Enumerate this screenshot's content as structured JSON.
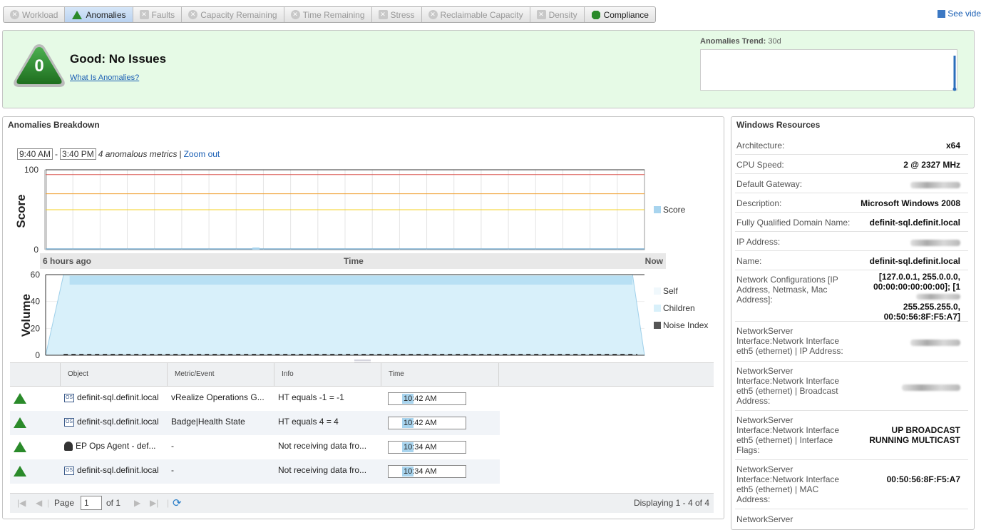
{
  "tabs": [
    {
      "label": "Workload",
      "icon": "workload-icon"
    },
    {
      "label": "Anomalies",
      "icon": "anomalies-icon"
    },
    {
      "label": "Faults",
      "icon": "faults-icon"
    },
    {
      "label": "Capacity Remaining",
      "icon": "capacity-icon"
    },
    {
      "label": "Time Remaining",
      "icon": "time-icon"
    },
    {
      "label": "Stress",
      "icon": "stress-icon"
    },
    {
      "label": "Reclaimable Capacity",
      "icon": "reclaimable-icon"
    },
    {
      "label": "Density",
      "icon": "density-icon"
    },
    {
      "label": "Compliance",
      "icon": "compliance-icon"
    }
  ],
  "see_video": "See vide",
  "status": {
    "score": "0",
    "title": "Good: No Issues",
    "link": "What Is Anomalies?",
    "trend_label": "Anomalies Trend:",
    "trend_period": "30d"
  },
  "breakdown": {
    "title": "Anomalies Breakdown",
    "range_start": "9:40 AM",
    "range_sep": "-",
    "range_end": "3:40 PM",
    "range_note": "4 anomalous metrics",
    "range_pipe": "|",
    "zoom_out": "Zoom out",
    "time_axis": {
      "left": "6 hours ago",
      "center": "Time",
      "right": "Now"
    }
  },
  "chart_data": [
    {
      "type": "line",
      "ylabel": "Score",
      "ylim": [
        0,
        100
      ],
      "yticks": [
        "100",
        "0"
      ],
      "thresholds": [
        {
          "value": 94,
          "color": "#d9534f"
        },
        {
          "value": 70,
          "color": "#f0a030"
        },
        {
          "value": 50,
          "color": "#f5d020"
        }
      ],
      "series": [
        {
          "name": "Score",
          "values": [
            0,
            0,
            0,
            0,
            0,
            0,
            0,
            0,
            0,
            0,
            0,
            0,
            0,
            0,
            0,
            0,
            0,
            0,
            0,
            0,
            0,
            0
          ],
          "color": "#a8d4ee"
        }
      ],
      "legend": "right"
    },
    {
      "type": "area",
      "ylabel": "Volume",
      "ylim": [
        0,
        60
      ],
      "yticks": [
        "60",
        "40",
        "20",
        "0"
      ],
      "x": [
        0,
        0.03,
        0.98,
        1
      ],
      "series": [
        {
          "name": "Self",
          "values": [
            0,
            0,
            0,
            0
          ],
          "color": "#f0f8fc"
        },
        {
          "name": "Children",
          "values": [
            0,
            60,
            60,
            0
          ],
          "color": "#d8f0fa"
        },
        {
          "name": "Noise Index",
          "values": [
            0,
            0,
            0,
            0
          ],
          "color": "#555555"
        }
      ],
      "legend": "right"
    }
  ],
  "grid": {
    "headers": [
      "Object",
      "Metric/Event",
      "Info",
      "Time"
    ],
    "rows": [
      {
        "object": "definit-sql.definit.local",
        "type": "os",
        "metric": "vRealize Operations G...",
        "info": "HT equals -1 = -1",
        "time": "10:42 AM"
      },
      {
        "object": "definit-sql.definit.local",
        "type": "os",
        "metric": "Badge|Health State",
        "info": "HT equals 4 = 4",
        "time": "10:42 AM"
      },
      {
        "object": "EP Ops Agent - def...",
        "type": "agent",
        "metric": "-",
        "info": "Not receiving data fro...",
        "time": "10:34 AM"
      },
      {
        "object": "definit-sql.definit.local",
        "type": "os",
        "metric": "-",
        "info": "Not receiving data fro...",
        "time": "10:34 AM"
      }
    ],
    "pager": {
      "page_label": "Page",
      "page": "1",
      "of": "of 1",
      "display": "Displaying 1 - 4 of 4"
    }
  },
  "resources": {
    "title": "Windows Resources",
    "items": [
      {
        "key": "Architecture:",
        "value": "x64"
      },
      {
        "key": "CPU Speed:",
        "value": "2 @ 2327 MHz"
      },
      {
        "key": "Default Gateway:",
        "value": ""
      },
      {
        "key": "Description:",
        "value": "Microsoft Windows 2008"
      },
      {
        "key": "Fully Qualified Domain Name:",
        "value": "definit-sql.definit.local"
      },
      {
        "key": "IP Address:",
        "value": ""
      },
      {
        "key": "Name:",
        "value": "definit-sql.definit.local"
      },
      {
        "key": "Network Configurations [IP Address, Netmask, Mac Address]:",
        "value": "[127.0.0.1, 255.0.0.0, 00:00:00:00:00:00]; [1",
        "value2": "255.255.255.0, 00:50:56:8F:F5:A7]"
      },
      {
        "key": "NetworkServer Interface:Network Interface eth5 (ethernet) | IP Address:",
        "value": ""
      },
      {
        "key": "NetworkServer Interface:Network Interface eth5 (ethernet) | Broadcast Address:",
        "value": ""
      },
      {
        "key": "NetworkServer Interface:Network Interface eth5 (ethernet) | Interface Flags:",
        "value": "UP BROADCAST RUNNING MULTICAST"
      },
      {
        "key": "NetworkServer Interface:Network Interface eth5 (ethernet) | MAC Address:",
        "value": "00:50:56:8F:F5:A7"
      },
      {
        "key": "NetworkServer",
        "value": ""
      }
    ]
  }
}
